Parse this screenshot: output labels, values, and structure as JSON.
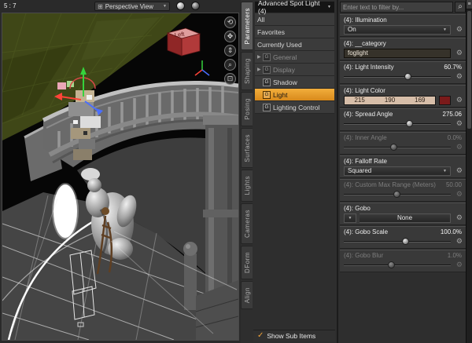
{
  "colors": {
    "accent_orange": "#e89a2e",
    "light_color_hex": "#d7bea9",
    "light_color_swatch": "#7a1a1a"
  },
  "icons": {
    "gear": "⚙",
    "dropdown": "▼",
    "expand": "▶",
    "check": "✓",
    "magnifier": "⌕",
    "menu": "≡",
    "grid": "⊞"
  },
  "viewport": {
    "aspect_label": "5 : 7",
    "view_selector": "Perspective View",
    "cube_label": "Left",
    "tools": [
      {
        "name": "orbit-tool",
        "glyph": "⟲"
      },
      {
        "name": "pan-tool",
        "glyph": "✥"
      },
      {
        "name": "dolly-tool",
        "glyph": "⇕"
      },
      {
        "name": "zoom-tool",
        "glyph": "⌕"
      },
      {
        "name": "frame-tool",
        "glyph": "⊡"
      }
    ]
  },
  "side_tabs": [
    "Parameters",
    "Shaping",
    "Posing",
    "Surfaces",
    "Lights",
    "Cameras",
    "DForm",
    "Align"
  ],
  "nav": {
    "header": "Advanced Spot Light (4)",
    "group_badge": "G",
    "items": [
      {
        "label": "All"
      },
      {
        "label": "Favorites"
      },
      {
        "label": "Currently Used"
      },
      {
        "label": "General",
        "group": true,
        "expandable": true,
        "disabled": true
      },
      {
        "label": "Display",
        "group": true,
        "expandable": true,
        "disabled": true
      },
      {
        "label": "Shadow",
        "group": true
      },
      {
        "label": "Light",
        "group": true,
        "selected": true
      },
      {
        "label": "Lighting Control",
        "group": true
      }
    ],
    "show_sub_items": "Show Sub Items"
  },
  "params": {
    "filter_placeholder": "Enter text to filter by...",
    "rows": [
      {
        "label": "(4): Illumination",
        "type": "dropdown",
        "value": "On"
      },
      {
        "label": "(4): __category",
        "type": "text",
        "value": "foglight"
      },
      {
        "label": "(4): Light Intensity",
        "type": "slider",
        "value": "60.7%",
        "pct": 60
      },
      {
        "label": "(4): Light Color",
        "type": "color",
        "r": "215",
        "g": "190",
        "b": "169"
      },
      {
        "label": "(4): Spread Angle",
        "type": "slider",
        "value": "275.06",
        "pct": 62
      },
      {
        "label": "(4): Inner Angle",
        "type": "slider",
        "value": "0.0%",
        "pct": 47,
        "disabled": true
      },
      {
        "label": "(4): Falloff Rate",
        "type": "dropdown",
        "value": "Squared"
      },
      {
        "label": "(4): Custom Max Range (Meters)",
        "type": "slider",
        "value": "50.00",
        "pct": 50,
        "disabled": true
      },
      {
        "label": "(4): Gobo",
        "type": "gobo",
        "value": "None"
      },
      {
        "label": "(4): Gobo Scale",
        "type": "slider",
        "value": "100.0%",
        "pct": 58
      },
      {
        "label": "(4): Gobo Blur",
        "type": "slider",
        "value": "1.0%",
        "pct": 45,
        "disabled": true
      }
    ]
  }
}
